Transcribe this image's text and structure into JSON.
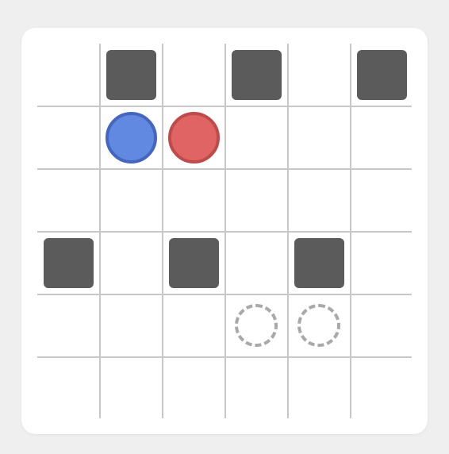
{
  "board": {
    "rows": 6,
    "cols": 6,
    "walls": [
      {
        "row": 0,
        "col": 1
      },
      {
        "row": 0,
        "col": 3
      },
      {
        "row": 0,
        "col": 5
      },
      {
        "row": 3,
        "col": 0
      },
      {
        "row": 3,
        "col": 2
      },
      {
        "row": 3,
        "col": 4
      }
    ],
    "pieces": [
      {
        "name": "blue-disc",
        "row": 1,
        "col": 1,
        "fill": "#6189e2",
        "stroke": "#4466bf"
      },
      {
        "name": "red-disc",
        "row": 1,
        "col": 2,
        "fill": "#e06464",
        "stroke": "#bf4a4a"
      }
    ],
    "targets": [
      {
        "row": 4,
        "col": 3
      },
      {
        "row": 4,
        "col": 4
      }
    ]
  },
  "colors": {
    "background": "#efefef",
    "card": "#ffffff",
    "grid": "#c8c8c8",
    "wall": "#5b5b5b",
    "target": "#a9a9a9"
  }
}
